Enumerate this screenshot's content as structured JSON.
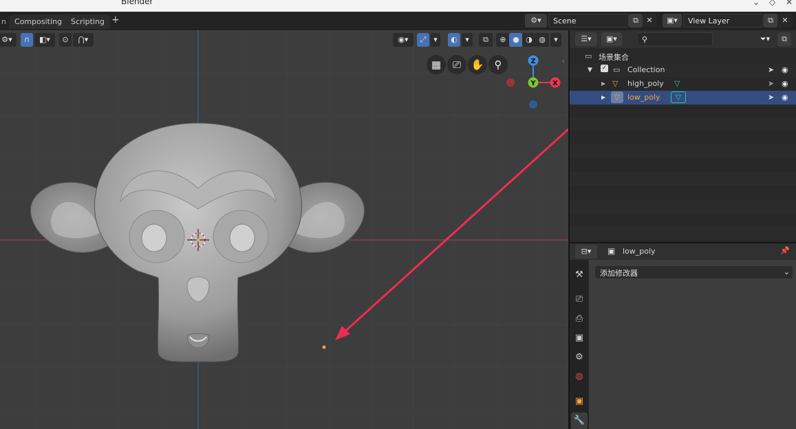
{
  "window": {
    "title": "Blender"
  },
  "workspace_tabs": [
    {
      "label": "Compositing"
    },
    {
      "label": "Scripting"
    }
  ],
  "add_tab_label": "+",
  "scene": {
    "name": "Scene"
  },
  "view_layer": {
    "name": "View Layer"
  },
  "axis_gizmo": {
    "z": "Z",
    "y": "Y",
    "x": "X"
  },
  "outliner": {
    "root_label": "场景集合",
    "collection_label": "Collection",
    "items": [
      {
        "label": "high_poly",
        "selected": false
      },
      {
        "label": "low_poly",
        "selected": true
      }
    ]
  },
  "properties": {
    "object_name": "low_poly",
    "add_modifier_label": "添加修改器"
  },
  "colors": {
    "accent": "#4772b3",
    "selected_row": "#334d80",
    "active_object_text": "#f7a33b",
    "annotation_arrow": "#ef2c55",
    "axis_x": "#f0344f",
    "axis_y": "#7bc52d",
    "axis_z": "#3f8fe2"
  }
}
